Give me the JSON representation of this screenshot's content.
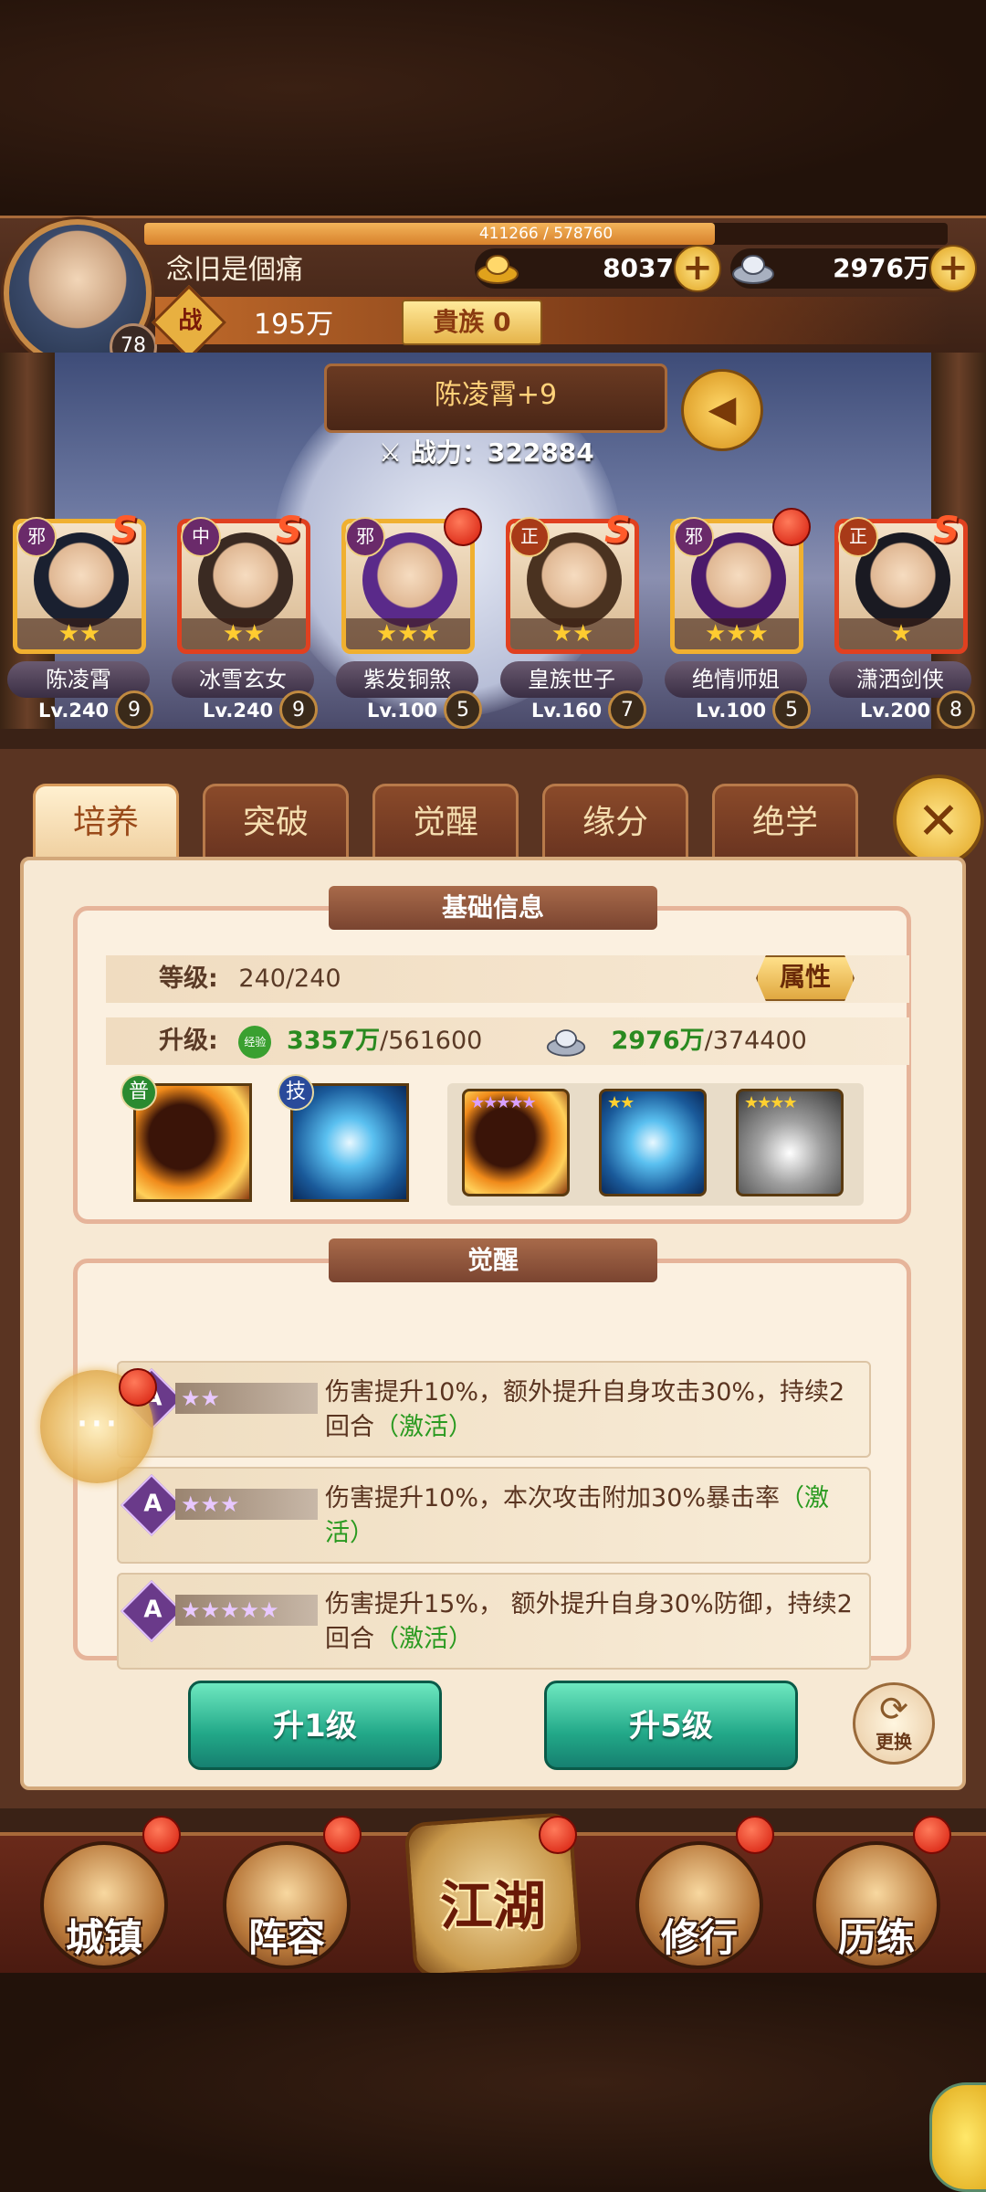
{
  "player": {
    "name": "念旧是個痛",
    "level": "78",
    "exp_text": "411266 / 578760",
    "exp_fraction": 0.71,
    "gold": "8037",
    "silver": "2976万",
    "power_icon": "战",
    "power": "195万",
    "noble_label": "貴族 0"
  },
  "hero": {
    "title": "陈凌霄+9",
    "power_label": "战力：",
    "power_value": "322884"
  },
  "roster": [
    {
      "name": "陈凌霄",
      "lv": "Lv.240",
      "badge": "9",
      "faction": "邪",
      "stars": "★★",
      "hair": "#1a2030",
      "border": "gold",
      "rank": "S",
      "dot": false
    },
    {
      "name": "冰雪玄女",
      "lv": "Lv.240",
      "badge": "9",
      "faction": "中",
      "stars": "★★",
      "hair": "#3a2a22",
      "border": "red",
      "rank": "S",
      "dot": false
    },
    {
      "name": "紫发铜煞",
      "lv": "Lv.100",
      "badge": "5",
      "faction": "邪",
      "stars": "★★★",
      "hair": "#5a2a8a",
      "border": "gold",
      "rank": "",
      "dot": true
    },
    {
      "name": "皇族世子",
      "lv": "Lv.160",
      "badge": "7",
      "faction": "正",
      "stars": "★★",
      "hair": "#4a3220",
      "border": "red",
      "rank": "S",
      "dot": false
    },
    {
      "name": "绝情师姐",
      "lv": "Lv.100",
      "badge": "5",
      "faction": "邪",
      "stars": "★★★",
      "hair": "#4a1a6a",
      "border": "gold",
      "rank": "",
      "dot": true
    },
    {
      "name": "潇洒剑侠",
      "lv": "Lv.200",
      "badge": "8",
      "faction": "正",
      "stars": "★",
      "hair": "#1a1a22",
      "border": "red",
      "rank": "S",
      "dot": false
    }
  ],
  "tabs": [
    "培养",
    "突破",
    "觉醒",
    "缘分",
    "绝学"
  ],
  "basic_info": {
    "title": "基础信息",
    "level_label": "等级:",
    "level_value": "240/240",
    "attr_button": "属性",
    "upgrade_label": "升级:",
    "exp_icon_label": "经验",
    "exp_have": "3357万",
    "exp_need": "/561600",
    "silver_have": "2976万",
    "silver_need": "/374400"
  },
  "skills": [
    {
      "tag": "普",
      "type": "fire"
    },
    {
      "tag": "技",
      "type": "ice"
    }
  ],
  "awaken_skills": [
    {
      "stars": "★★★★★",
      "type": "fire"
    },
    {
      "stars": "★★",
      "type": "ice"
    },
    {
      "stars": "★★★★",
      "type": "mist"
    }
  ],
  "awaken": {
    "title": "觉醒",
    "rows": [
      {
        "stars": "★★",
        "text": "伤害提升10%，额外提升自身攻击30%，持续2回合",
        "status": "（激活）"
      },
      {
        "stars": "★★★",
        "text": "伤害提升10%，本次攻击附加30%暴击率",
        "status": "（激活）"
      },
      {
        "stars": "★★★★★",
        "text": "伤害提升15%， 额外提升自身30%防御，持续2回合",
        "status": "（激活）"
      }
    ],
    "icon_letter": "A"
  },
  "buttons": {
    "up1": "升1级",
    "up5": "升5级",
    "swap": "更换"
  },
  "nav": [
    "城镇",
    "阵容",
    "江湖",
    "修行",
    "历练"
  ],
  "colors": {
    "accent_gold": "#e0a21c",
    "active_green": "#2a9a20"
  }
}
